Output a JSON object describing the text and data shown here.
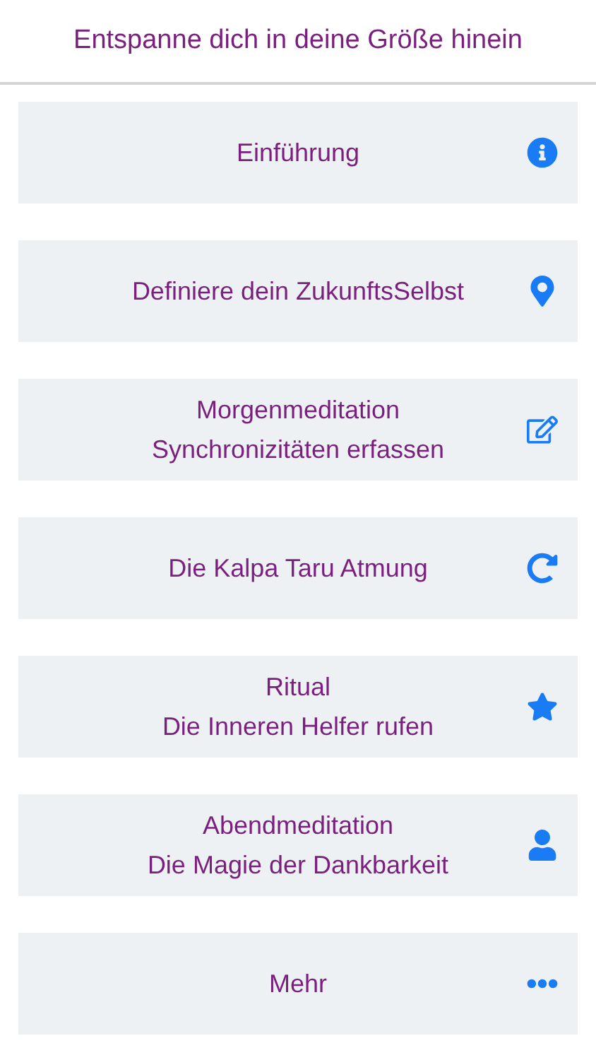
{
  "header": {
    "title": "Entspanne dich in deine Größe hinein"
  },
  "items": [
    {
      "lines": [
        "Einführung"
      ]
    },
    {
      "lines": [
        "Definiere dein ZukunftsSelbst"
      ]
    },
    {
      "lines": [
        "Morgenmeditation",
        "Synchronizitäten erfassen"
      ]
    },
    {
      "lines": [
        "Die Kalpa Taru Atmung"
      ]
    },
    {
      "lines": [
        "Ritual",
        "Die Inneren Helfer rufen"
      ]
    },
    {
      "lines": [
        "Abendmeditation",
        "Die Magie der Dankbarkeit"
      ]
    },
    {
      "lines": [
        "Mehr"
      ]
    }
  ]
}
